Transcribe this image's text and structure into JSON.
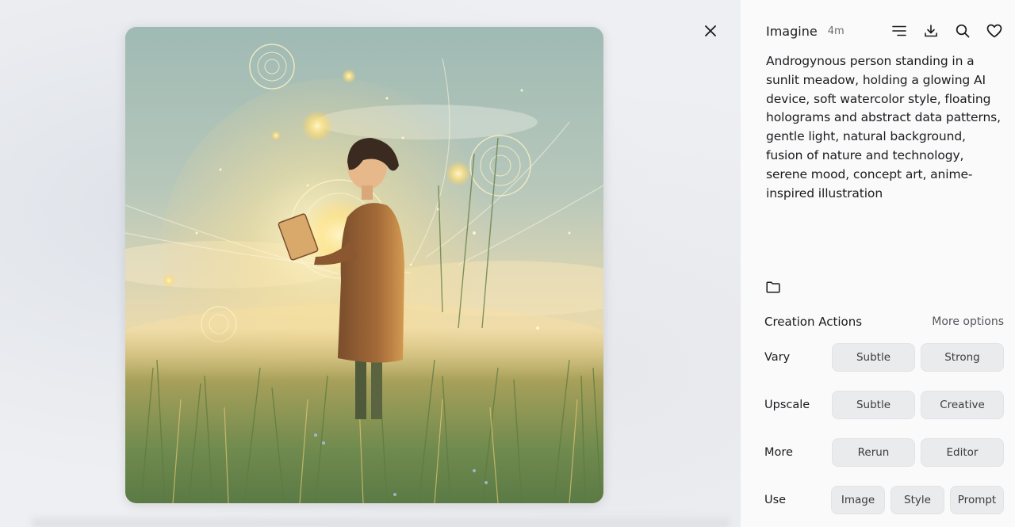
{
  "viewer": {
    "close_icon": "close-icon",
    "image_alt": "Generated image: person in a sunlit meadow holding a glowing device"
  },
  "panel": {
    "title": "Imagine",
    "age": "4m",
    "icons": [
      "menu-lines-icon",
      "download-icon",
      "search-icon",
      "heart-icon"
    ],
    "prompt": "Androgynous person standing in a sunlit meadow, holding a glowing AI device, soft watercolor style, floating holograms and abstract data patterns, gentle light, natural background, fusion of nature and technology, serene mood, concept art, anime-inspired illustration",
    "folder_icon": "folder-icon"
  },
  "actions": {
    "title": "Creation Actions",
    "more_options": "More options",
    "rows": [
      {
        "label": "Vary",
        "buttons": [
          "Subtle",
          "Strong"
        ]
      },
      {
        "label": "Upscale",
        "buttons": [
          "Subtle",
          "Creative"
        ]
      },
      {
        "label": "More",
        "buttons": [
          "Rerun",
          "Editor"
        ]
      },
      {
        "label": "Use",
        "buttons": [
          "Image",
          "Style",
          "Prompt"
        ]
      }
    ]
  }
}
